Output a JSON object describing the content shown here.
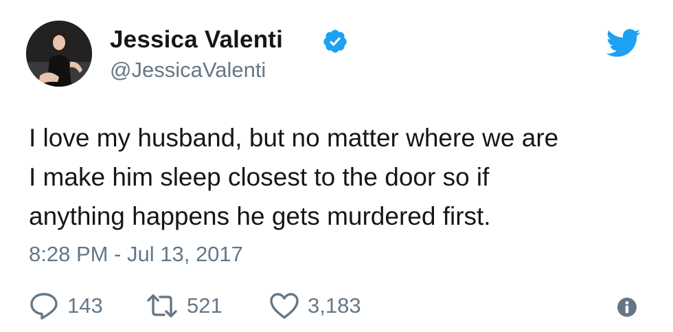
{
  "author": {
    "display_name": "Jessica Valenti",
    "handle": "@JessicaValenti",
    "verified": true
  },
  "tweet": {
    "text_lines": [
      "I love my husband, but no matter where we are",
      "I make him sleep closest to the door so if",
      "anything happens he gets murdered first."
    ],
    "timestamp": "8:28 PM - Jul 13, 2017"
  },
  "stats": {
    "replies": "143",
    "retweets": "521",
    "likes": "3,183"
  },
  "icons": {
    "verified": "verified-badge-icon",
    "brand": "twitter-bird-icon",
    "reply": "reply-icon",
    "retweet": "retweet-icon",
    "like": "heart-icon",
    "info": "info-icon"
  },
  "colors": {
    "twitter_blue": "#1da1f2",
    "text": "#14171a",
    "muted": "#657786"
  }
}
